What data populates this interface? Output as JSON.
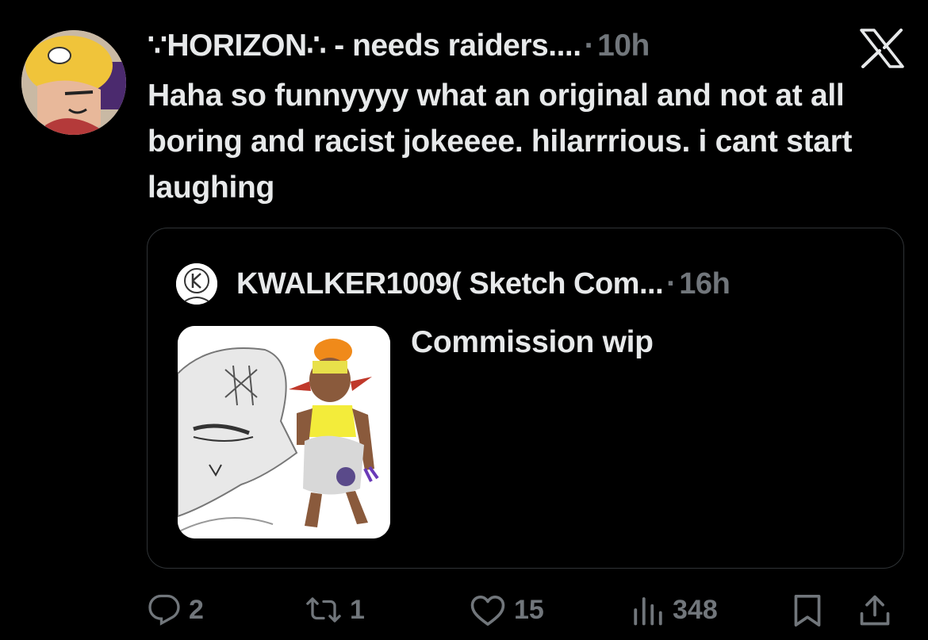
{
  "tweet": {
    "author_name": "∵HORIZON∴ - needs raiders....",
    "separator": "·",
    "time": "10h",
    "text": "Haha so funnyyyy what an original and not at all boring and racist jokeeee. hilarrrious. i cant start laughing"
  },
  "quoted_tweet": {
    "author_name": "KWALKER1009( Sketch Com...",
    "separator": "·",
    "time": "16h",
    "text": "Commission wip"
  },
  "actions": {
    "replies": "2",
    "retweets": "1",
    "likes": "15",
    "views": "348"
  },
  "icons": {
    "logo": "x-logo-icon",
    "reply": "reply-icon",
    "retweet": "retweet-icon",
    "like": "heart-icon",
    "views": "views-icon",
    "bookmark": "bookmark-icon",
    "share": "share-icon"
  },
  "colors": {
    "background": "#000000",
    "text_primary": "#e7e9ea",
    "text_secondary": "#71767b",
    "card_border": "#2f3336"
  }
}
